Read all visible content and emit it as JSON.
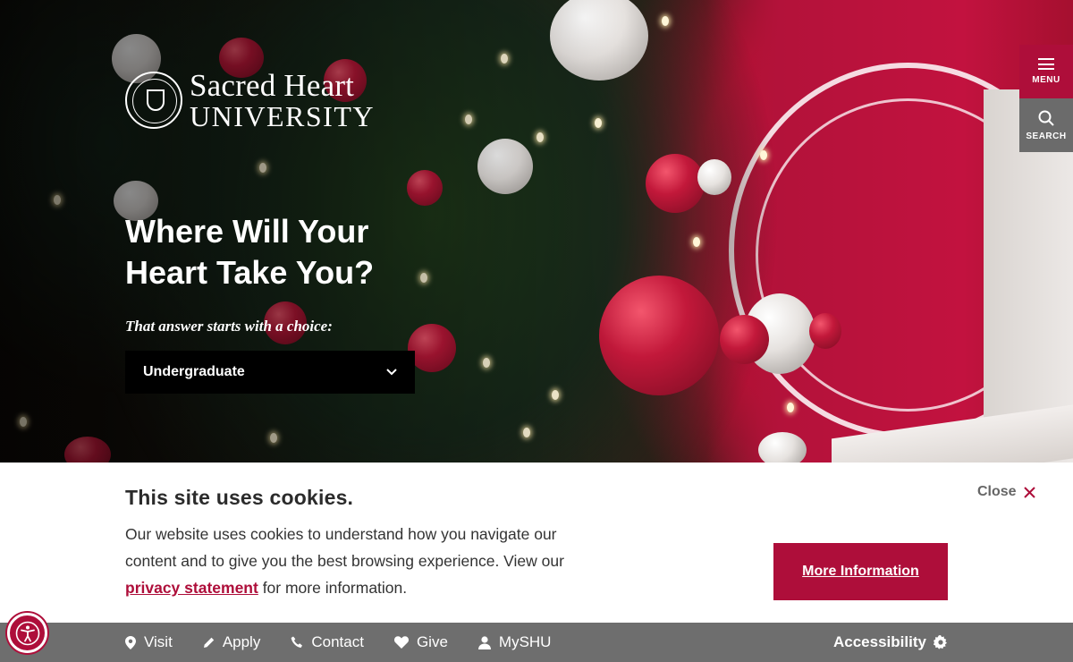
{
  "brand": {
    "line1": "Sacred Heart",
    "line2": "UNIVERSITY"
  },
  "sidenav": {
    "menu_label": "MENU",
    "search_label": "SEARCH"
  },
  "hero": {
    "headline": "Where Will Your Heart Take You?",
    "tagline": "That answer starts with a choice:",
    "select_value": "Undergraduate"
  },
  "cookie": {
    "title": "This site uses cookies.",
    "text_before": "Our website uses cookies to understand how you navigate our content and to give you the best browsing experience. View our ",
    "link_text": "privacy statement",
    "text_after": " for more information.",
    "close_label": "Close",
    "more_label": "More Information"
  },
  "bottombar": {
    "links": [
      {
        "label": "Visit",
        "icon": "map-pin-icon"
      },
      {
        "label": "Apply",
        "icon": "pencil-icon"
      },
      {
        "label": "Contact",
        "icon": "phone-icon"
      },
      {
        "label": "Give",
        "icon": "heart-icon"
      },
      {
        "label": "MySHU",
        "icon": "user-icon"
      }
    ],
    "accessibility_label": "Accessibility"
  },
  "colors": {
    "brand_red": "#ae0e3a",
    "bar_gray": "#6e6e6e"
  }
}
